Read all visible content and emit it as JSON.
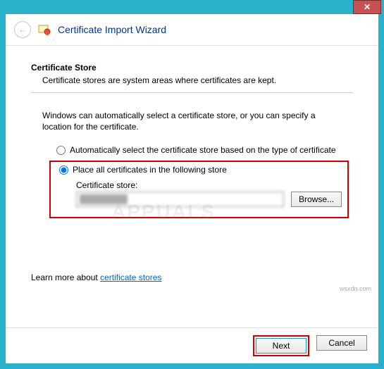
{
  "titlebar": {
    "close_glyph": "✕"
  },
  "header": {
    "back_glyph": "←",
    "title": "Certificate Import Wizard"
  },
  "content": {
    "section_title": "Certificate Store",
    "section_desc": "Certificate stores are system areas where certificates are kept.",
    "body_text": "Windows can automatically select a certificate store, or you can specify a location for the certificate.",
    "radio_auto_label": "Automatically select the certificate store based on the type of certificate",
    "radio_place_label": "Place all certificates in the following store",
    "store_label": "Certificate store:",
    "store_value": "████████",
    "browse_label": "Browse...",
    "learn_more_prefix": "Learn more about ",
    "learn_more_link": "certificate stores"
  },
  "footer": {
    "next_label": "Next",
    "cancel_label": "Cancel"
  },
  "watermark": "APPUALS",
  "credit": "wsxdn.com"
}
